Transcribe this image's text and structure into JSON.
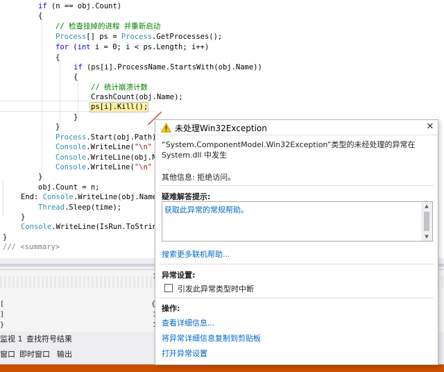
{
  "code": {
    "line1": {
      "kw": "if",
      "rest": " (n == obj.Count)"
    },
    "line2": "{",
    "line3": "// 检查挂掉的进程 并重新启动",
    "line4": {
      "type1": "Process",
      "mid1": "[] ps = ",
      "type2": "Process",
      "rest": ".GetProcesses();"
    },
    "line5": {
      "kw1": "for",
      "mid1": " (",
      "kw2": "int",
      "rest": " i = 0; i < ps.Length; i++)"
    },
    "line6": "{",
    "line7": {
      "kw": "if",
      "rest": " (ps[i].ProcessName.StartsWith(obj.Name))"
    },
    "line8": "{",
    "line9": "// 统计崩溃计数",
    "line10": "CrashCount(obj.Name);",
    "line11": "ps[i].Kill();",
    "line12": "}",
    "line13": "}",
    "line14": {
      "type": "Process",
      "rest": ".Start(obj.Path)"
    },
    "line15": {
      "type": "Console",
      "mid": ".WriteLine(",
      "str": "\"\\n\""
    },
    "line16": {
      "type": "Console",
      "rest": ".WriteLine(obj.N"
    },
    "line17": {
      "type": "Console",
      "mid": ".WriteLine(",
      "str": "\"\\n\""
    },
    "line18": "}",
    "line19": "obj.Count = n;",
    "line20": {
      "label": "End:",
      "type": "Console",
      "rest": ".WriteLine(obj.Name"
    },
    "line21": {
      "type": "Thread",
      "rest": ".Sleep(time);"
    },
    "line22": "}",
    "line23": {
      "type": "Console",
      "rest": ".WriteLine(IsRun.ToStrin"
    },
    "line24": "}",
    "line25": {
      "slashes": "///",
      "tag": " <summary>"
    }
  },
  "bottom_pane": {
    "col1": "1",
    "col2": "{",
    "col3": "1",
    "col4": "1",
    "marks": [
      "[",
      "]",
      "}"
    ],
    "tabs_row1": [
      "监视 1",
      "查找符号结果"
    ],
    "tabs_row2": [
      "窗口",
      "即时窗口",
      "输出"
    ]
  },
  "exception_popup": {
    "title": "未处理Win32Exception",
    "message": "“System.ComponentModel.Win32Exception”类型的未经处理的异常在 System.dll 中发生",
    "other_info": "其他信息: 拒绝访问。",
    "tips_title": "疑难解答提示:",
    "tips_link": "获取此异常的常规帮助。",
    "search_online": "搜索更多联机帮助...",
    "exception_settings_title": "异常设置:",
    "break_checkbox_label": "引发此异常类型时中断",
    "break_checked": false,
    "actions_title": "操作:",
    "actions": [
      "查看详细信息...",
      "将异常详细信息复制到剪贴板",
      "打开异常设置"
    ],
    "colors": {
      "link": "#0066cc",
      "warning": "#f2c40f"
    }
  },
  "icons": [
    "warning-icon",
    "close-icon"
  ],
  "colors": {
    "keyword": "#0000ff",
    "type": "#2b91af",
    "comment": "#008000",
    "string": "#a31515",
    "accent_bar": "#ca5100"
  }
}
